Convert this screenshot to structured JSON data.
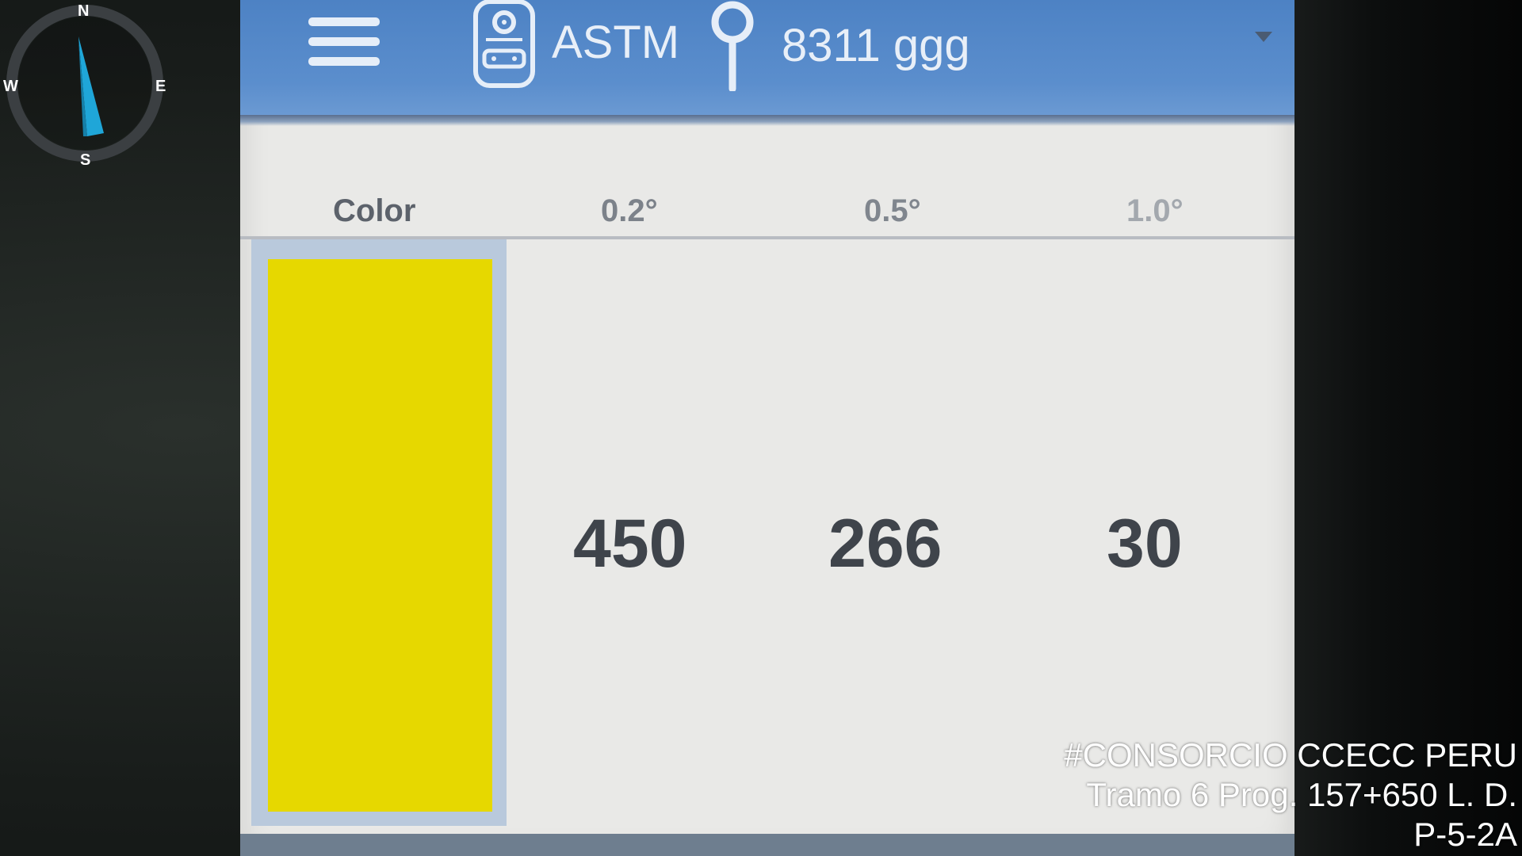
{
  "compass": {
    "north": "N",
    "south": "S",
    "west": "W",
    "east": "E",
    "needle_color": "#1fa6d8",
    "needle_heading_deg": 10
  },
  "topbar": {
    "menu_icon": "hamburger-menu-icon",
    "device_icon": "device-icon",
    "standard": "ASTM",
    "location_icon": "pin-icon",
    "sample": "8311 ggg",
    "dropdown_icon": "caret-down-icon",
    "background_color": "#5b8ecd"
  },
  "table": {
    "headers": {
      "color": "Color",
      "angle_1": "0.2°",
      "angle_2": "0.5°",
      "angle_3": "1.0°"
    },
    "swatch_color": "#e6d800",
    "values": {
      "angle_1": "450",
      "angle_2": "266",
      "angle_3": "30"
    }
  },
  "stamp": {
    "line1": "#CONSORCIO CCECC PERU",
    "line2": "Tramo 6 Prog. 157+650 L. D.",
    "line3": "P-5-2A"
  }
}
